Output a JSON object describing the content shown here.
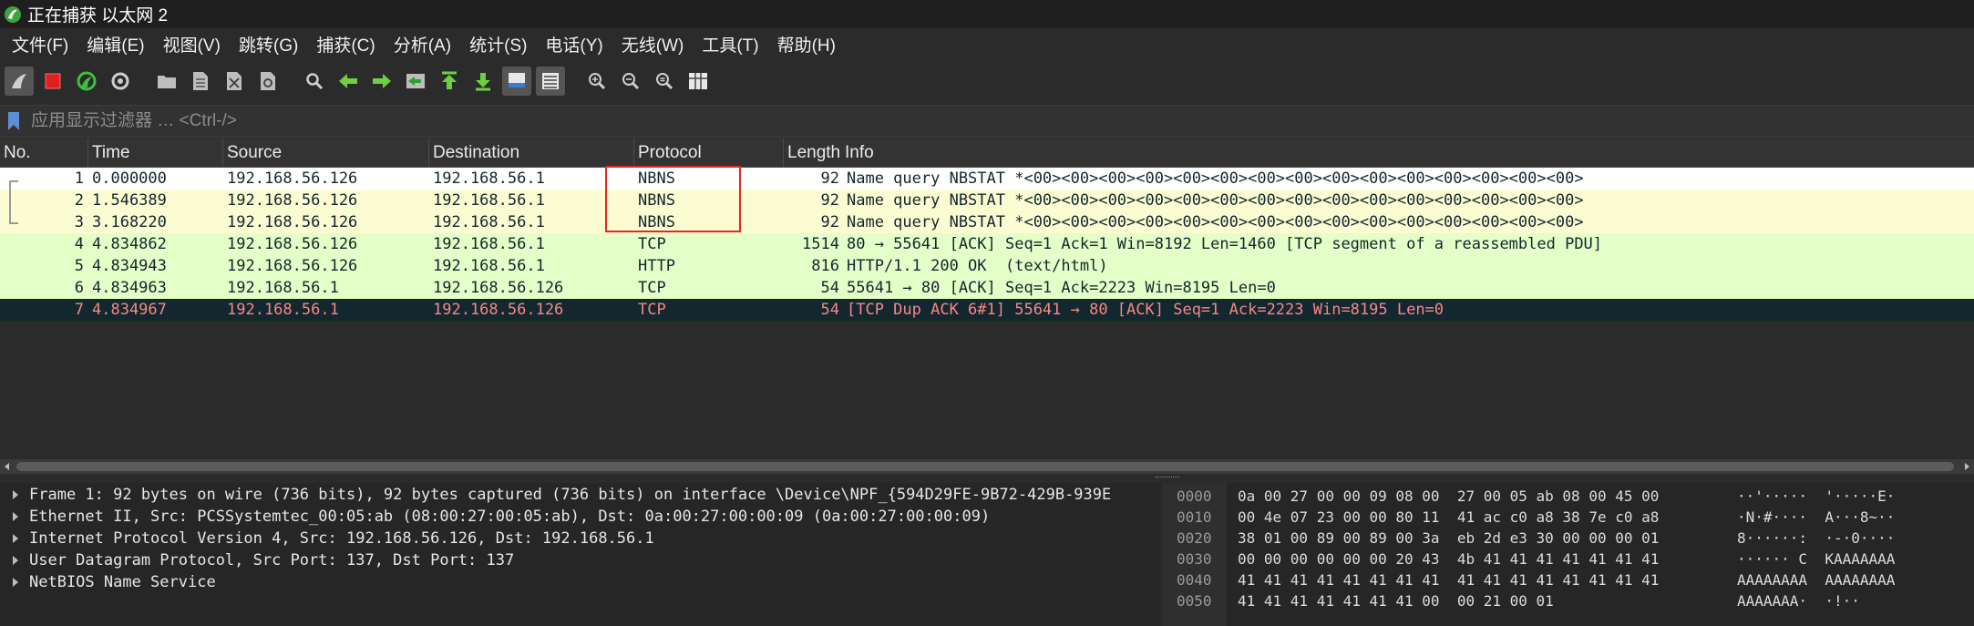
{
  "window": {
    "title": "正在捕获 以太网 2"
  },
  "menu": [
    "文件(F)",
    "编辑(E)",
    "视图(V)",
    "跳转(G)",
    "捕获(C)",
    "分析(A)",
    "统计(S)",
    "电话(Y)",
    "无线(W)",
    "工具(T)",
    "帮助(H)"
  ],
  "toolbar": {
    "icons": [
      "shark-fin-start-icon",
      "stop-capture-icon",
      "restart-capture-icon",
      "capture-options-icon",
      "open-file-icon",
      "save-file-icon",
      "close-file-icon",
      "reload-file-icon",
      "find-packet-icon",
      "go-back-icon",
      "go-forward-icon",
      "go-to-packet-icon",
      "first-packet-icon",
      "last-packet-icon",
      "auto-scroll-icon",
      "colorize-icon",
      "zoom-in-icon",
      "zoom-out-icon",
      "normal-size-icon",
      "resize-columns-icon"
    ]
  },
  "filter": {
    "placeholder": "应用显示过滤器 … <Ctrl-/>"
  },
  "packet_list": {
    "columns": [
      "No.",
      "Time",
      "Source",
      "Destination",
      "Protocol",
      "Length",
      "Info"
    ],
    "rows": [
      {
        "no": "1",
        "time": "0.000000",
        "source": "192.168.56.126",
        "destination": "192.168.56.1",
        "protocol": "NBNS",
        "length": "92",
        "info": "Name query NBSTAT *<00><00><00><00><00><00><00><00><00><00><00><00><00><00><00>",
        "bg": "#ffffff",
        "fg": "#12272e",
        "selected": true
      },
      {
        "no": "2",
        "time": "1.546389",
        "source": "192.168.56.126",
        "destination": "192.168.56.1",
        "protocol": "NBNS",
        "length": "92",
        "info": "Name query NBSTAT *<00><00><00><00><00><00><00><00><00><00><00><00><00><00><00>",
        "bg": "#fcfcd2",
        "fg": "#12272e",
        "selected": false
      },
      {
        "no": "3",
        "time": "3.168220",
        "source": "192.168.56.126",
        "destination": "192.168.56.1",
        "protocol": "NBNS",
        "length": "92",
        "info": "Name query NBSTAT *<00><00><00><00><00><00><00><00><00><00><00><00><00><00><00>",
        "bg": "#fcfcd2",
        "fg": "#12272e",
        "selected": false
      },
      {
        "no": "4",
        "time": "4.834862",
        "source": "192.168.56.126",
        "destination": "192.168.56.1",
        "protocol": "TCP",
        "length": "1514",
        "info": "80 → 55641 [ACK] Seq=1 Ack=1 Win=8192 Len=1460 [TCP segment of a reassembled PDU]",
        "bg": "#e4ffc7",
        "fg": "#12272e",
        "selected": false
      },
      {
        "no": "5",
        "time": "4.834943",
        "source": "192.168.56.126",
        "destination": "192.168.56.1",
        "protocol": "HTTP",
        "length": "816",
        "info": "HTTP/1.1 200 OK  (text/html)",
        "bg": "#e4ffc7",
        "fg": "#12272e",
        "selected": false
      },
      {
        "no": "6",
        "time": "4.834963",
        "source": "192.168.56.1",
        "destination": "192.168.56.126",
        "protocol": "TCP",
        "length": "54",
        "info": "55641 → 80 [ACK] Seq=1 Ack=2223 Win=8195 Len=0",
        "bg": "#e4ffc7",
        "fg": "#12272e",
        "selected": false
      },
      {
        "no": "7",
        "time": "4.834967",
        "source": "192.168.56.1",
        "destination": "192.168.56.126",
        "protocol": "TCP",
        "length": "54",
        "info": "[TCP Dup ACK 6#1] 55641 → 80 [ACK] Seq=1 Ack=2223 Win=8195 Len=0",
        "bg": "#12272e",
        "fg": "#f78787",
        "selected": false
      }
    ]
  },
  "details": [
    "Frame 1: 92 bytes on wire (736 bits), 92 bytes captured (736 bits) on interface \\Device\\NPF_{594D29FE-9B72-429B-939E",
    "Ethernet II, Src: PCSSystemtec_00:05:ab (08:00:27:00:05:ab), Dst: 0a:00:27:00:00:09 (0a:00:27:00:00:09)",
    "Internet Protocol Version 4, Src: 192.168.56.126, Dst: 192.168.56.1",
    "User Datagram Protocol, Src Port: 137, Dst Port: 137",
    "NetBIOS Name Service"
  ],
  "bytes": [
    {
      "offset": "0000",
      "hex": "0a 00 27 00 00 09 08 00  27 00 05 ab 08 00 45 00",
      "ascii": "··'·····  '·····E·"
    },
    {
      "offset": "0010",
      "hex": "00 4e 07 23 00 00 80 11  41 ac c0 a8 38 7e c0 a8",
      "ascii": "·N·#····  A···8~··"
    },
    {
      "offset": "0020",
      "hex": "38 01 00 89 00 89 00 3a  eb 2d e3 30 00 00 00 01",
      "ascii": "8······:  ·-·0····"
    },
    {
      "offset": "0030",
      "hex": "00 00 00 00 00 00 20 43  4b 41 41 41 41 41 41 41",
      "ascii": "······ C  KAAAAAAA"
    },
    {
      "offset": "0040",
      "hex": "41 41 41 41 41 41 41 41  41 41 41 41 41 41 41 41",
      "ascii": "AAAAAAAA  AAAAAAAA"
    },
    {
      "offset": "0050",
      "hex": "41 41 41 41 41 41 41 00  00 21 00 01",
      "ascii": "AAAAAAA·  ·!··"
    }
  ],
  "colors": {
    "highlight": "#e52626",
    "background": "#2b2b2b"
  }
}
